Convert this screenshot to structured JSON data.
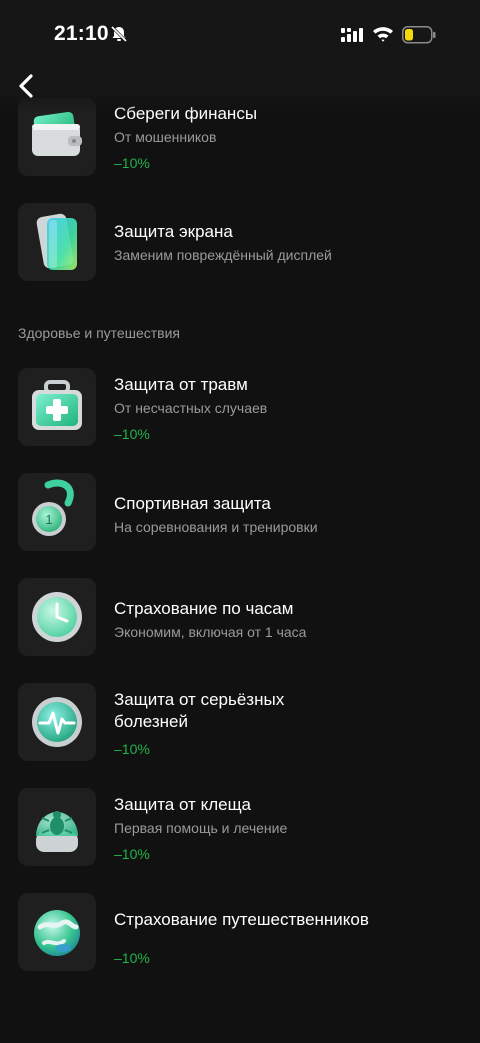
{
  "status_bar": {
    "time": "21:10",
    "icons": [
      "bell-muted-icon",
      "cellular-signal-icon",
      "wifi-icon",
      "battery-low-icon"
    ],
    "battery_color": "#f5d90a"
  },
  "nav": {
    "back_icon": "chevron-left-icon"
  },
  "colors": {
    "background": "#111111",
    "tile": "#1f1f1f",
    "discount": "#21b24a",
    "subtitle": "#9a9a9a"
  },
  "sections": [
    {
      "label": "",
      "items": [
        {
          "title": "Сбереги финансы",
          "subtitle": "От мошенников",
          "discount": "–10%",
          "icon": "wallet-icon"
        },
        {
          "title": "Защита экрана",
          "subtitle": "Заменим повреждённый дисплей",
          "discount": "",
          "icon": "phone-screen-icon"
        }
      ]
    },
    {
      "label": "Здоровье и путешествия",
      "items": [
        {
          "title": "Защита от травм",
          "subtitle": "От несчастных случаев",
          "discount": "–10%",
          "icon": "first-aid-kit-icon"
        },
        {
          "title": "Спортивная защита",
          "subtitle": "На соревнования и тренировки",
          "discount": "",
          "icon": "medal-icon"
        },
        {
          "title": "Страхование по часам",
          "subtitle": "Экономим, включая от 1 часа",
          "discount": "",
          "icon": "clock-icon"
        },
        {
          "title": "Защита от серьёзных болезней",
          "subtitle": "",
          "discount": "–10%",
          "icon": "heartbeat-icon"
        },
        {
          "title": "Защита от клеща",
          "subtitle": "Первая помощь и лечение",
          "discount": "–10%",
          "icon": "tick-bug-icon"
        },
        {
          "title": "Страхование путешественников",
          "subtitle": "",
          "discount": "–10%",
          "icon": "globe-icon"
        }
      ]
    }
  ]
}
